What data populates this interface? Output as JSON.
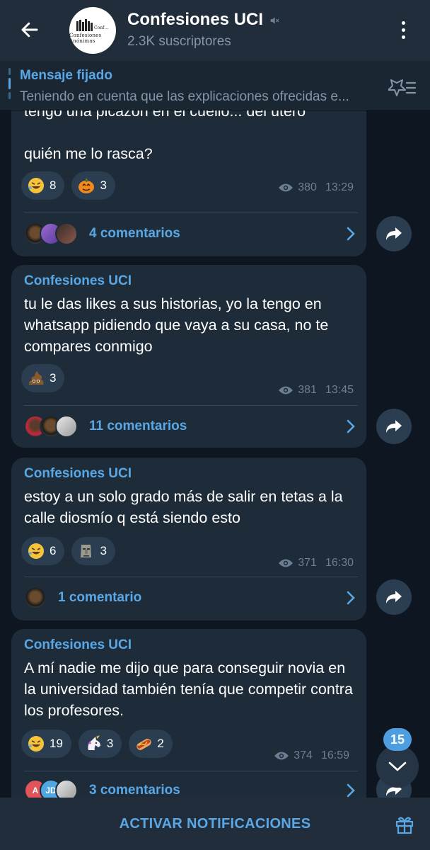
{
  "header": {
    "title": "Confesiones UCI",
    "subtitle": "2.3K suscriptores",
    "logo_text": "Confesiones Anónimas"
  },
  "pinned": {
    "title": "Mensaje fijado",
    "text": "Teniendo en cuenta que las explicaciones ofrecidas e..."
  },
  "messages": [
    {
      "lines": [
        "tengo una picazón en el cuello... del útero",
        "",
        "quién me lo rasca?"
      ],
      "reactions": [
        {
          "emoji": "rofl",
          "count": "8"
        },
        {
          "emoji": "pumpkin",
          "count": "3"
        }
      ],
      "views": "380",
      "time": "13:29",
      "comments": "4 comentarios"
    },
    {
      "author": "Confesiones UCI",
      "text": "tu le das likes a sus historias, yo la tengo en whatsapp pidiendo que vaya a su casa, no te compares conmigo",
      "reactions": [
        {
          "emoji": "poop",
          "count": "3"
        }
      ],
      "views": "381",
      "time": "13:45",
      "comments": "11 comentarios"
    },
    {
      "author": "Confesiones UCI",
      "text": "estoy a un solo grado más de salir en tetas a la calle diosmío q está siendo esto",
      "reactions": [
        {
          "emoji": "rofl",
          "count": "6"
        },
        {
          "emoji": "moai",
          "count": "3"
        }
      ],
      "views": "371",
      "time": "16:30",
      "comments": "1 comentario"
    },
    {
      "author": "Confesiones UCI",
      "text": "A mí nadie me dijo que para conseguir novia en la universidad también tenía que competir contra los profesores.",
      "reactions": [
        {
          "emoji": "rofl",
          "count": "19"
        },
        {
          "emoji": "unicorn",
          "count": "3"
        },
        {
          "emoji": "hotdog",
          "count": "2"
        }
      ],
      "views": "374",
      "time": "16:59",
      "comments": "3 comentarios",
      "comment_avatars": [
        "A",
        "JD"
      ]
    }
  ],
  "scroll": {
    "unread_count": "15"
  },
  "bottom": {
    "notify_label": "ACTIVAR NOTIFICACIONES"
  }
}
